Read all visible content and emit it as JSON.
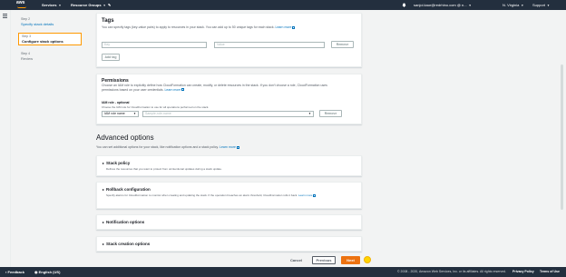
{
  "topnav": {
    "logo": "aws",
    "services": "Services",
    "resource_groups": "Resource Groups",
    "account": "sanjoi.kaur@redrhino.com @ n...",
    "region": "N. Virginia",
    "support": "Support",
    "icons": [
      "bell-icon",
      "caret-down-icon"
    ]
  },
  "steps": [
    {
      "num": "Step 2",
      "title": "Specify stack details"
    },
    {
      "num": "Step 3",
      "title": "Configure stack options"
    },
    {
      "num": "Step 4",
      "title": "Review"
    }
  ],
  "tags": {
    "heading": "Tags",
    "description": "You can specify tags (key-value pairs) to apply to resources in your stack. You can add up to 50 unique tags for each stack.",
    "learn_more": "Learn more",
    "key_placeholder": "Key",
    "value_placeholder": "Value",
    "remove": "Remove",
    "add_tag": "Add tag"
  },
  "permissions": {
    "heading": "Permissions",
    "description": "Choose an IAM role to explicitly define how CloudFormation can create, modify, or delete resources in the stack. If you don't choose a role, CloudFormation uses permissions based on your user credentials.",
    "learn_more": "Learn more",
    "iam_label": "IAM role - optional",
    "iam_desc": "Choose the IAM role for CloudFormation to use for all operations performed on the stack.",
    "role_type": "IAM role name",
    "role_placeholder": "Sample-role-name",
    "remove": "Remove"
  },
  "advanced": {
    "title": "Advanced options",
    "description": "You can set additional options for your stack, like notification options and a stack policy.",
    "learn_more": "Learn more"
  },
  "expanders": [
    {
      "title": "Stack policy",
      "sub": "Defines the resources that you want to protect from unintentional updates during a stack update."
    },
    {
      "title": "Rollback configuration",
      "sub": "Specify alarms for CloudFormation to monitor when creating and updating the stack. If the operation breaches an alarm threshold, CloudFormation rolls it back.",
      "learn_more": "Learn more"
    },
    {
      "title": "Notification options",
      "sub": ""
    },
    {
      "title": "Stack creation options",
      "sub": ""
    }
  ],
  "actions": {
    "cancel": "Cancel",
    "previous": "Previous",
    "next": "Next"
  },
  "bottombar": {
    "feedback": "Feedback",
    "language": "English (US)",
    "copyright": "© 2008 - 2020, Amazon Web Services, Inc. or its affiliates. All rights reserved.",
    "privacy": "Privacy Policy",
    "terms": "Terms of Use"
  },
  "colors": {
    "nav_bg": "#232f3e",
    "primary_button": "#ec7211",
    "link": "#0073bb",
    "active_step_border": "#ff9900"
  }
}
